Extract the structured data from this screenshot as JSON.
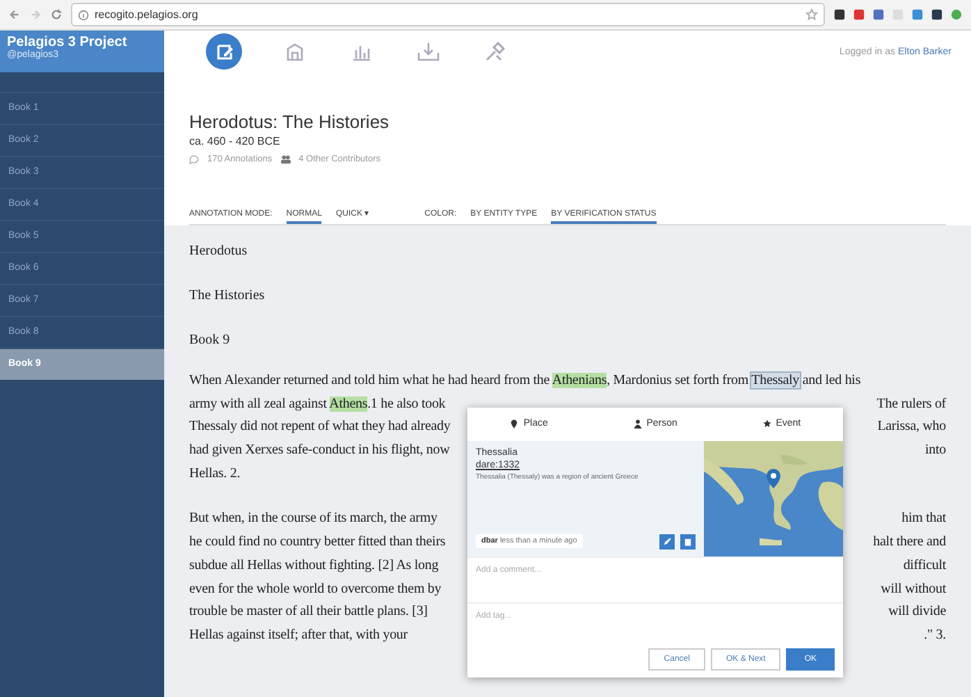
{
  "browser": {
    "url_host": "recogito.pelagios.org"
  },
  "project": {
    "name": "Pelagios 3 Project",
    "handle": "@pelagios3"
  },
  "toolbar": [
    {
      "kind": "edit",
      "selected": true
    },
    {
      "kind": "map",
      "selected": false
    },
    {
      "kind": "stats",
      "selected": false
    },
    {
      "kind": "download",
      "selected": false
    },
    {
      "kind": "settings",
      "selected": false
    }
  ],
  "user": {
    "prefix": "Logged in as",
    "name": "Elton Barker"
  },
  "sidebar": {
    "items": [
      {
        "label": "Book 1",
        "selected": false
      },
      {
        "label": "Book 2",
        "selected": false
      },
      {
        "label": "Book 3",
        "selected": false
      },
      {
        "label": "Book 4",
        "selected": false
      },
      {
        "label": "Book 5",
        "selected": false
      },
      {
        "label": "Book 6",
        "selected": false
      },
      {
        "label": "Book 7",
        "selected": false
      },
      {
        "label": "Book 8",
        "selected": false
      },
      {
        "label": "Book 9",
        "selected": true
      }
    ]
  },
  "document": {
    "title": "Herodotus: The Histories",
    "date": "ca. 460 - 420 BCE",
    "annotations": "170 Annotations",
    "contributors": "4 Other Contributors"
  },
  "mode_bar": {
    "label": "ANNOTATION MODE:",
    "modes": [
      {
        "label": "NORMAL",
        "selected": true
      },
      {
        "label": "QUICK ▾",
        "selected": false
      }
    ],
    "color_label": "COLOR:",
    "color_options": [
      {
        "label": "BY ENTITY TYPE",
        "selected": false
      },
      {
        "label": "BY VERIFICATION STATUS",
        "selected": true
      }
    ]
  },
  "text": {
    "headings": [
      "Herodotus",
      "The Histories",
      "Book 9"
    ],
    "paragraphs": [
      {
        "lines": [
          {
            "left": [
              {
                "text": "When Alexander returned and told him what he had heard from the "
              },
              {
                "text": "Athenians",
                "verified": true
              },
              {
                "text": ", Mardonius set forth from "
              },
              {
                "text": "Thessaly",
                "verified": false
              },
              {
                "text": " and led his"
              }
            ]
          },
          {
            "left": [
              {
                "text": "army with all zeal against "
              },
              {
                "text": "Athens",
                "verified": true
              },
              {
                "text": ".1 he also took"
              }
            ],
            "right": "The rulers of"
          },
          {
            "left": [
              {
                "text": "Thessaly did not repent of what they had already"
              }
            ],
            "right": "Larissa, who"
          },
          {
            "left": [
              {
                "text": "had given Xerxes safe-conduct in his flight, now"
              }
            ],
            "right": "into"
          },
          {
            "left": [
              {
                "text": "Hellas. 2."
              }
            ]
          }
        ]
      },
      {
        "lines": [
          {
            "left": [
              {
                "text": "But when, in the course of its march, the army"
              }
            ],
            "right": "him that"
          },
          {
            "left": [
              {
                "text": "he could find no country better fitted than theirs"
              }
            ],
            "right": "halt there and"
          },
          {
            "left": [
              {
                "text": "subdue all Hellas without fighting. [2] As long"
              }
            ],
            "right": "difficult"
          },
          {
            "left": [
              {
                "text": "even for the whole world to overcome them by"
              }
            ],
            "right": "will without"
          },
          {
            "left": [
              {
                "text": "trouble be master of all their battle plans. [3]"
              }
            ],
            "right": "will divide"
          },
          {
            "left": [
              {
                "text": "Hellas against itself; after that, with your"
              }
            ],
            "right": ".\" 3."
          }
        ]
      }
    ]
  },
  "popup": {
    "tabs": [
      {
        "label": "Place",
        "kind": "place"
      },
      {
        "label": "Person",
        "kind": "person"
      },
      {
        "label": "Event",
        "kind": "event"
      }
    ],
    "place": {
      "name": "Thessalia",
      "uri": "dare:1332",
      "description": "Thessalia (Thessaly) was a region of ancient Greece"
    },
    "tag": {
      "user": "dbar",
      "time": "less than a minute ago"
    },
    "comment": {
      "placeholder": "Add a comment..."
    },
    "tags": {
      "placeholder": "Add tag..."
    },
    "buttons": [
      {
        "label": "Cancel",
        "kind": "secondary"
      },
      {
        "label": "OK & Next",
        "kind": "secondary"
      },
      {
        "label": "OK",
        "kind": "primary"
      }
    ]
  }
}
